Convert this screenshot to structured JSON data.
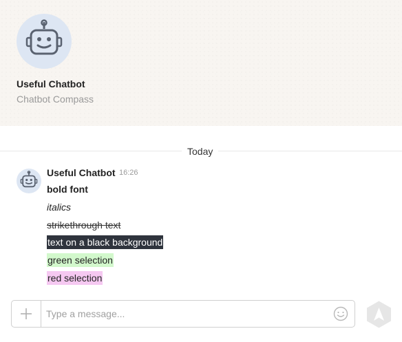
{
  "header": {
    "bot_name": "Useful Chatbot",
    "bot_subtitle": "Chatbot Compass",
    "avatar_icon": "robot-icon"
  },
  "divider": {
    "label": "Today"
  },
  "message": {
    "author": "Useful Chatbot",
    "time": "16:26",
    "avatar_icon": "robot-icon",
    "lines": [
      "bold font",
      "italics",
      "strikethrough text",
      "text on a black background",
      "green selection",
      "red selection"
    ]
  },
  "composer": {
    "placeholder": "Type a message...",
    "add_icon": "plus-icon",
    "emoji_icon": "smiley-icon",
    "send_icon": "send-arrow-icon"
  },
  "colors": {
    "header_bg": "#f8f5f1",
    "avatar_bg": "#dde6f3",
    "black_bg": "#2f343d",
    "green_bg": "#d2f8cc",
    "red_bg": "#f5c8f1"
  }
}
